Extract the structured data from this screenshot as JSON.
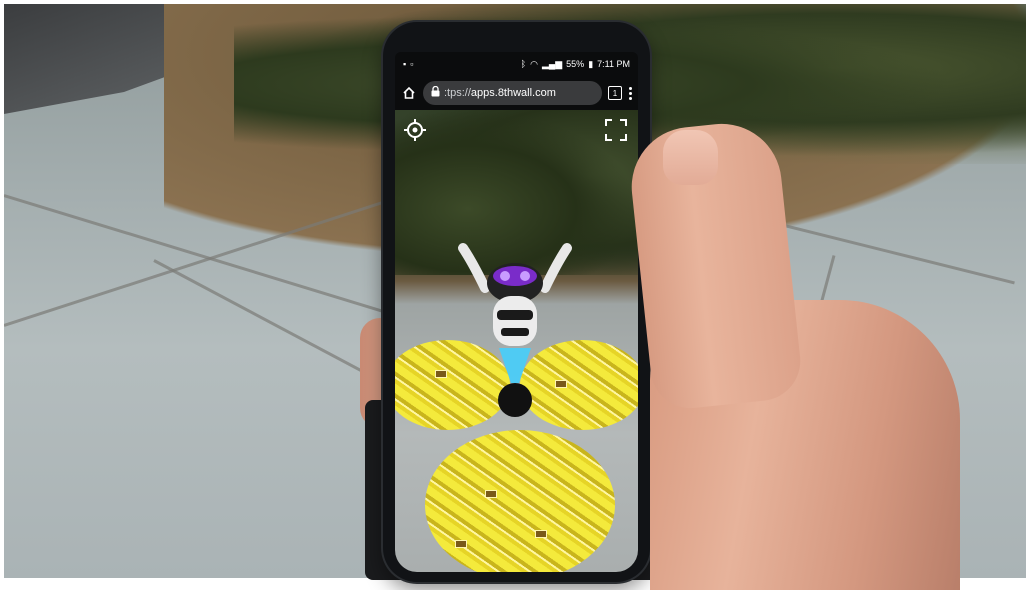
{
  "status_bar": {
    "battery": "55%",
    "time": "7:11 PM"
  },
  "browser": {
    "url_prefix": ":tps://",
    "url_domain": "apps.8thwall.com",
    "tab_count": "1"
  },
  "icons": {
    "home": "home-icon",
    "lock": "lock-icon",
    "tabs": "tabs-icon",
    "menu": "more-vert-icon",
    "recenter": "crosshair-icon",
    "fullscreen": "fullscreen-icon",
    "wifi": "wifi-icon",
    "signal": "signal-icon",
    "battery": "battery-icon",
    "bluetooth": "bluetooth-icon"
  },
  "colors": {
    "accent_glow": "#3fd0ff",
    "robot_visor": "#7a2cc9",
    "gold": "#f2e43a"
  }
}
